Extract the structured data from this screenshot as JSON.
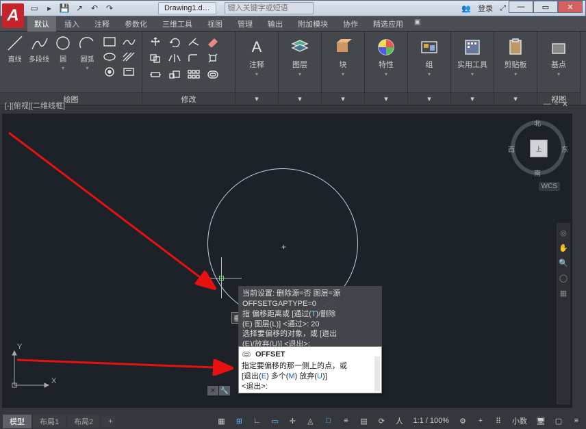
{
  "titlebar": {
    "filename": "Drawing1.d…",
    "search_placeholder": "键入关键字或短语",
    "login": "登录"
  },
  "tabs": [
    "默认",
    "插入",
    "注释",
    "参数化",
    "三维工具",
    "视图",
    "管理",
    "输出",
    "附加模块",
    "协作",
    "精选应用"
  ],
  "draw": {
    "panel": "绘图",
    "line": "直线",
    "pline": "多段线",
    "circle": "圆",
    "arc": "圆弧"
  },
  "modify": {
    "panel": "修改"
  },
  "panels": {
    "annotate": "注释",
    "layer": "图层",
    "block": "块",
    "props": "特性",
    "group": "组",
    "util": "实用工具",
    "clip": "剪贴板",
    "base": "基点",
    "view": "视图"
  },
  "viewport_label": "[-][俯视][二维线框]",
  "viewcube": {
    "n": "北",
    "e": "东",
    "s": "南",
    "w": "西"
  },
  "wcs": "WCS",
  "perp": "垂足",
  "ttdark": {
    "l1": "当前设置: 删除源=否  图层=源",
    "l2": "OFFSETGAPTYPE=0",
    "l3a": "指   偏移距离或 [通过(",
    "l3b": ")/删除",
    "l4": "(E) 图层(L)] <通过>:   20",
    "l5": "选择要偏移的对象，或 [退出",
    "l6": "(E)/放弃(U)] <退出>:"
  },
  "ttwhite": {
    "cmd": "OFFSET",
    "l1": "指定要偏移的那一侧上的点，或",
    "l2a": "[退出(",
    "l2b": ") 多个(",
    "l2c": ") 放弃(",
    "l2d": ")]",
    "l3": "<退出>:"
  },
  "layout": {
    "model": "模型",
    "l1": "布局1",
    "l2": "布局2"
  },
  "status": {
    "scale": "1:1 / 100%",
    "prec": "小数"
  },
  "ucs": {
    "x": "X",
    "y": "Y"
  }
}
